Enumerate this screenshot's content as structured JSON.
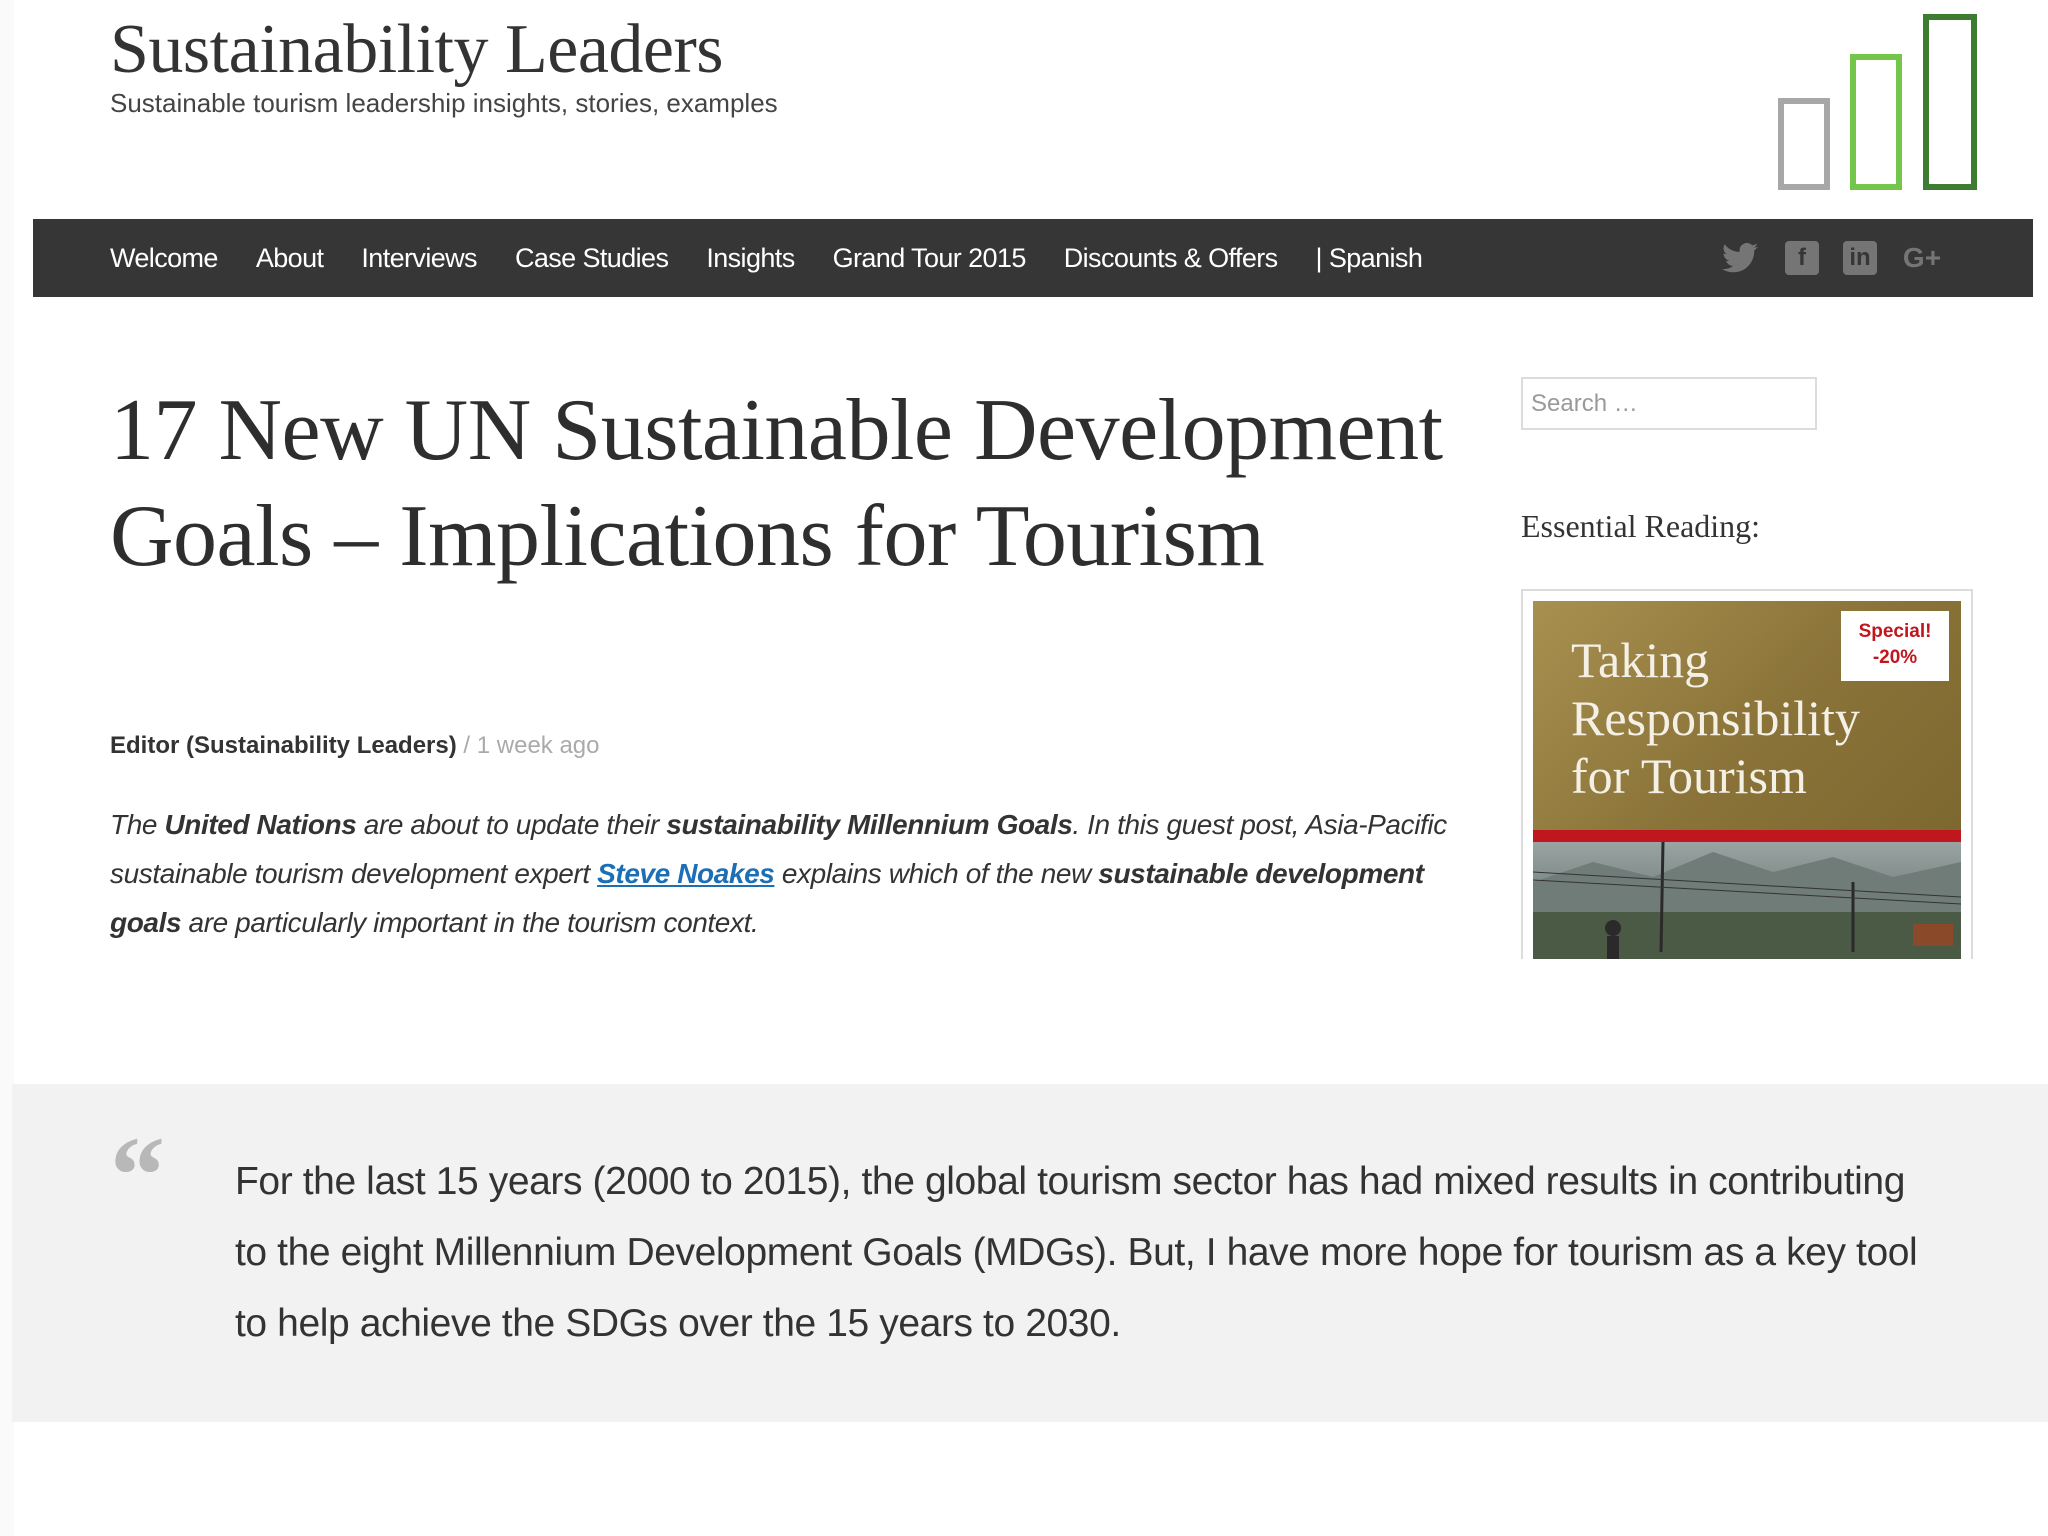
{
  "header": {
    "site_title": "Sustainability Leaders",
    "tagline": "Sustainable tourism leadership insights, stories, examples"
  },
  "nav": {
    "items": [
      {
        "label": "Welcome"
      },
      {
        "label": "About"
      },
      {
        "label": "Interviews"
      },
      {
        "label": "Case Studies"
      },
      {
        "label": "Insights"
      },
      {
        "label": "Grand Tour 2015"
      },
      {
        "label": "Discounts & Offers"
      },
      {
        "label": "| Spanish"
      }
    ],
    "social": [
      {
        "icon": "twitter-icon",
        "glyph": "🐦︎"
      },
      {
        "icon": "facebook-icon",
        "glyph": "f"
      },
      {
        "icon": "linkedin-icon",
        "glyph": "in"
      },
      {
        "icon": "google-plus-icon",
        "glyph": "G+"
      }
    ]
  },
  "article": {
    "title": "17 New UN Sustainable Development Goals – Implications for Tourism",
    "author": "Editor (Sustainability Leaders)",
    "separator": " / ",
    "time": "1 week ago",
    "intro": {
      "p1": "The ",
      "b1": "United Nations",
      "p2": " are about to update their ",
      "b2": "sustainability Millennium Goals",
      "p3": ". In this guest post, Asia-Pacific sustainable tourism development expert ",
      "link": "Steve Noakes",
      "p4": " explains which of the new ",
      "b3": "sustainable development goals",
      "p5": " are particularly important in the tourism context."
    }
  },
  "sidebar": {
    "search_placeholder": "Search …",
    "heading": "Essential Reading:",
    "book": {
      "title": "Taking Responsibility for Tourism",
      "badge_line1": "Special!",
      "badge_line2": "-20%"
    }
  },
  "quote": {
    "mark": "“",
    "text": "For the last 15 years (2000 to 2015), the global tourism sector has had mixed results in contributing to the eight Millennium Development Goals (MDGs). But, I have more hope for tourism as a key tool to help achieve the SDGs over the 15 years to 2030."
  },
  "colors": {
    "nav_bg": "#363636",
    "link": "#1d6fb5",
    "logo_grey": "#a7a7a7",
    "logo_light_green": "#73c649",
    "logo_dark_green": "#3d7d32",
    "badge_red": "#c0161d"
  }
}
